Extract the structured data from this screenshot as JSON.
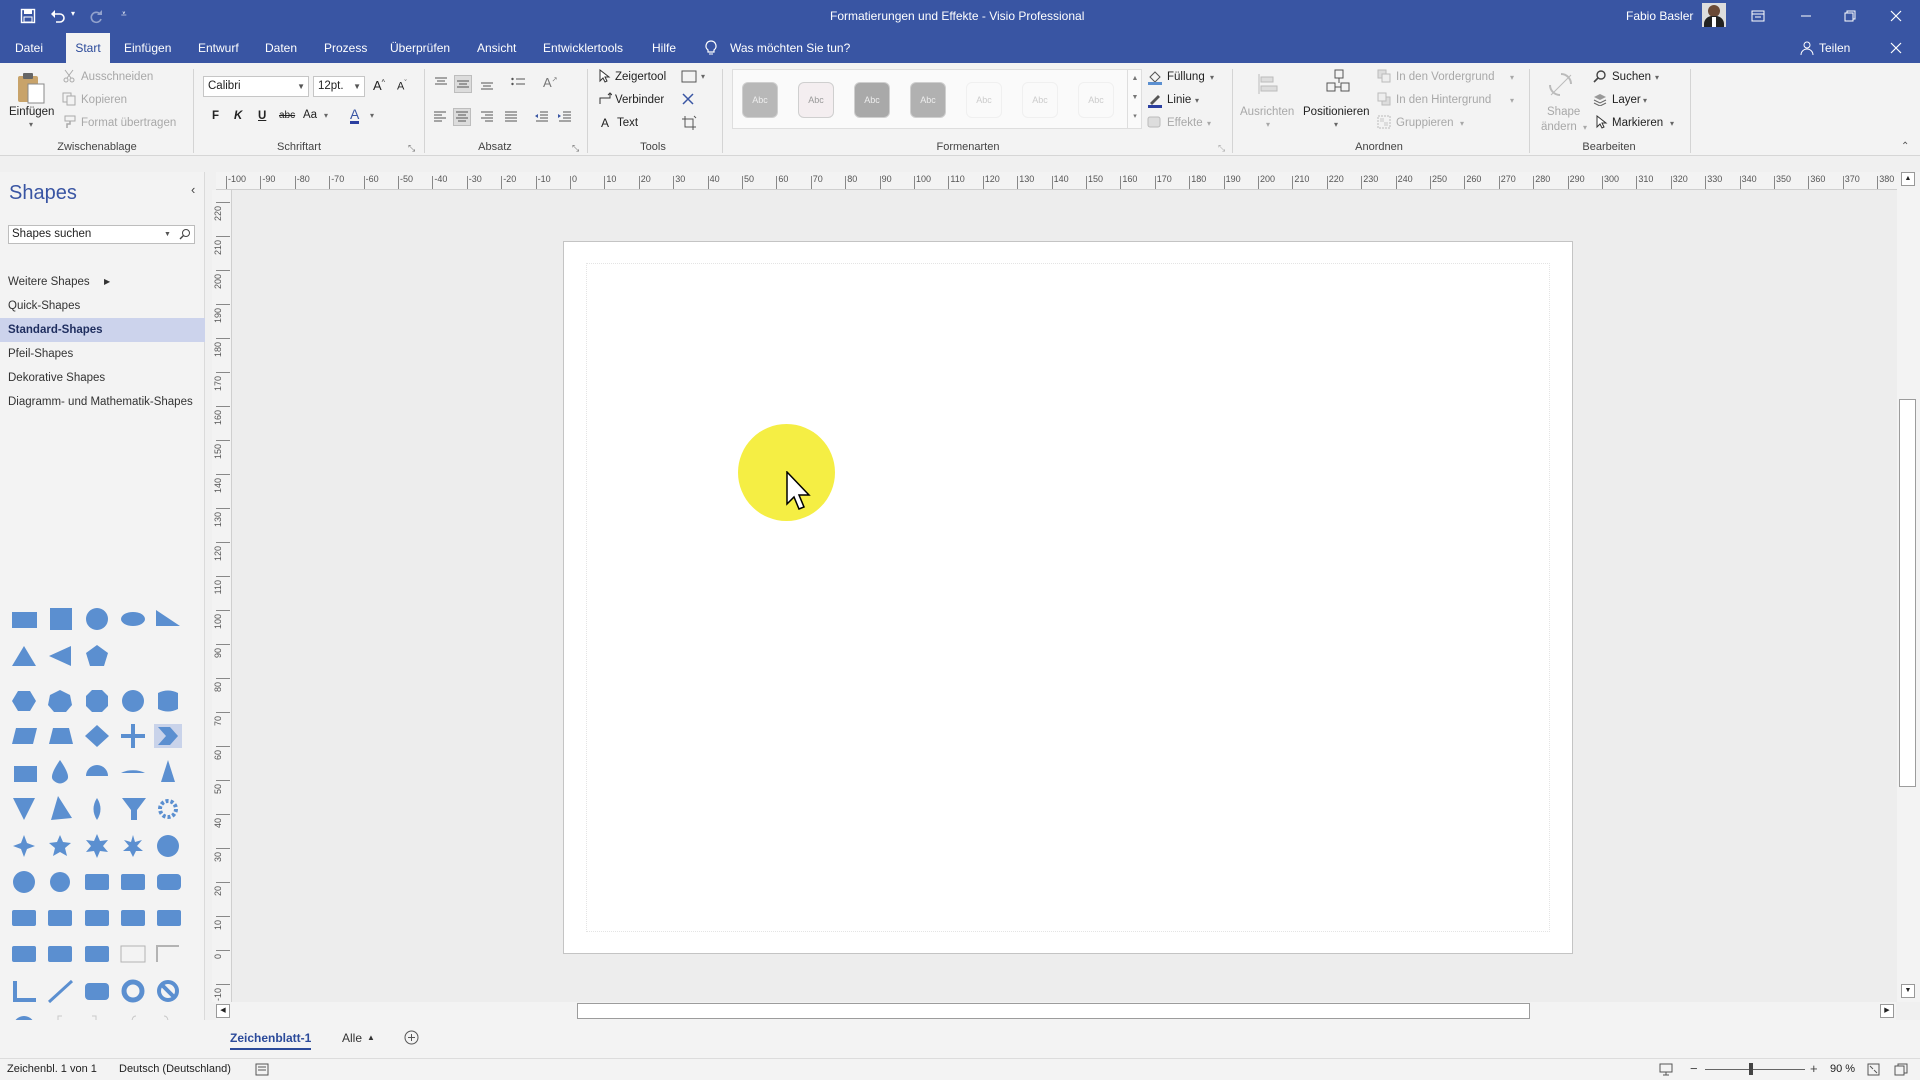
{
  "window": {
    "title": "Formatierungen und Effekte - Visio Professional",
    "user": "Fabio Basler"
  },
  "tabs": [
    "Datei",
    "Start",
    "Einfügen",
    "Entwurf",
    "Daten",
    "Prozess",
    "Überprüfen",
    "Ansicht",
    "Entwicklertools",
    "Hilfe"
  ],
  "tell_me": "Was möchten Sie tun?",
  "share": "Teilen",
  "ribbon": {
    "clipboard": {
      "label": "Zwischenablage",
      "paste": "Einfügen",
      "cut": "Ausschneiden",
      "copy": "Kopieren",
      "format_painter": "Format übertragen"
    },
    "font": {
      "label": "Schriftart",
      "font_name": "Calibri",
      "font_size": "12pt.",
      "bold": "F",
      "italic": "K",
      "underline": "U",
      "strike": "abc",
      "case": "Aa",
      "color": "A"
    },
    "paragraph": {
      "label": "Absatz"
    },
    "tools": {
      "label": "Tools",
      "pointer": "Zeigertool",
      "connector": "Verbinder",
      "text": "Text"
    },
    "shape_styles": {
      "label": "Formenarten",
      "sample": "Abc",
      "fill": "Füllung",
      "line": "Linie",
      "effects": "Effekte"
    },
    "arrange": {
      "label": "Anordnen",
      "align": "Ausrichten",
      "position": "Positionieren",
      "front": "In den Vordergrund",
      "back": "In den Hintergrund",
      "group": "Gruppieren"
    },
    "editing": {
      "label": "Bearbeiten",
      "change_shape_1": "Shape",
      "change_shape_2": "ändern",
      "find": "Suchen",
      "layers": "Layer",
      "select": "Markieren"
    }
  },
  "shapes_pane": {
    "title": "Shapes",
    "search_placeholder": "Shapes suchen",
    "items": [
      "Weitere Shapes",
      "Quick-Shapes",
      "Standard-Shapes",
      "Pfeil-Shapes",
      "Dekorative Shapes",
      "Diagramm- und Mathematik-Shapes"
    ],
    "selected": "Standard-Shapes"
  },
  "ruler": {
    "h": [
      "-100",
      "-90",
      "-80",
      "-70",
      "-60",
      "-50",
      "-40",
      "-30",
      "-20",
      "-10",
      "0",
      "10",
      "20",
      "30",
      "40",
      "50",
      "60",
      "70",
      "80",
      "90",
      "100",
      "110",
      "120",
      "130",
      "140",
      "150",
      "160",
      "170",
      "180",
      "190",
      "200",
      "210",
      "220",
      "230",
      "240",
      "250",
      "260",
      "270",
      "280",
      "290",
      "300",
      "310",
      "320",
      "330",
      "340",
      "350",
      "360",
      "370",
      "380"
    ],
    "v": [
      "220",
      "210",
      "200",
      "190",
      "180",
      "170",
      "160",
      "150",
      "140",
      "130",
      "120",
      "110",
      "100",
      "90",
      "80",
      "70",
      "60",
      "50",
      "40",
      "30",
      "20",
      "10",
      "0",
      "-10"
    ]
  },
  "sheet": {
    "name": "Zeichenblatt-1",
    "all": "Alle"
  },
  "status": {
    "page": "Zeichenbl. 1 von 1",
    "language": "Deutsch (Deutschland)",
    "zoom": "90 %"
  },
  "colors": {
    "accent": "#3955a3",
    "shape_fill": "#5b8fd0",
    "highlight": "#f5ee44"
  }
}
